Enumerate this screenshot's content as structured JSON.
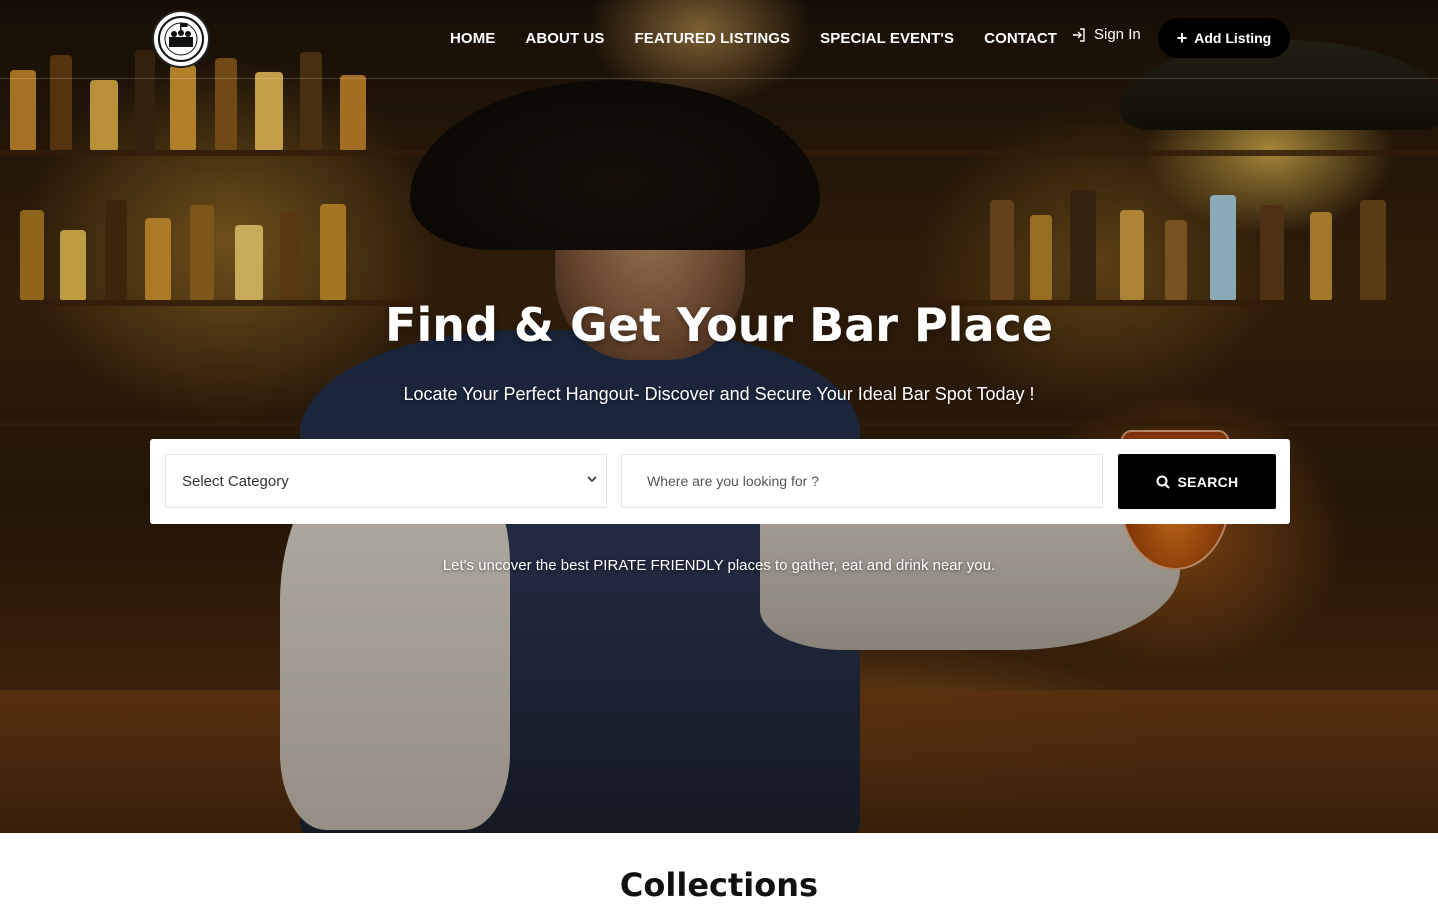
{
  "brand": {
    "logo_alt": "Pirate friendly places logo"
  },
  "nav": {
    "items": [
      {
        "label": "HOME"
      },
      {
        "label": "ABOUT US"
      },
      {
        "label": "FEATURED LISTINGS"
      },
      {
        "label": "SPECIAL EVENT'S"
      },
      {
        "label": "CONTACT"
      }
    ],
    "sign_in": "Sign In",
    "add_listing": "Add Listing",
    "sign_in_icon": "sign-in-icon",
    "add_icon": "plus-icon"
  },
  "hero": {
    "title": "Find & Get Your Bar Place",
    "subtitle": "Locate Your Perfect Hangout- Discover and Secure Your Ideal Bar Spot Today !",
    "tagline": "Let's uncover the best PIRATE FRIENDLY places to gather, eat and drink near you."
  },
  "search": {
    "category_selected": "Select Category",
    "location_placeholder": "Where are you looking for ?",
    "button_label": "SEARCH",
    "button_icon": "search-icon"
  },
  "collections": {
    "title": "Collections"
  },
  "colors": {
    "primary_button": "#000000",
    "text_light": "#ffffff",
    "heading_dark": "#111111"
  }
}
